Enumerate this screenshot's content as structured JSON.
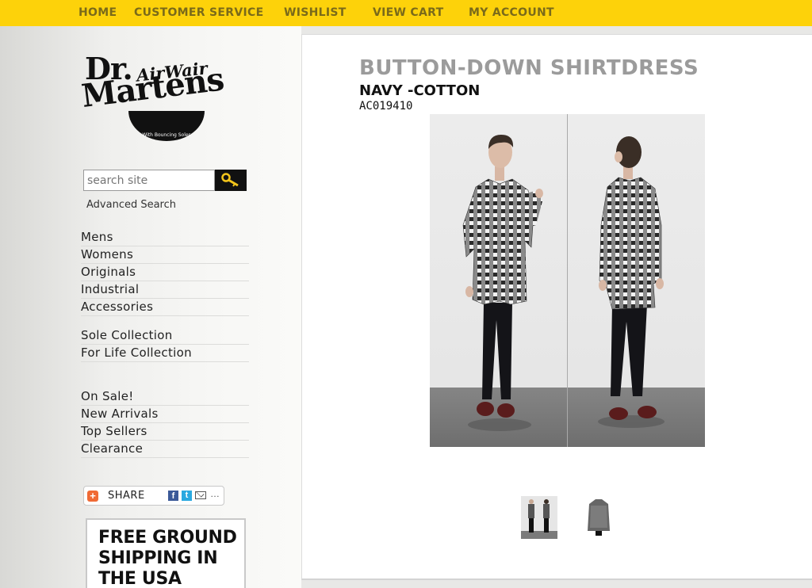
{
  "topnav": {
    "items": [
      "HOME",
      "CUSTOMER SERVICE",
      "WISHLIST",
      "VIEW CART",
      "MY ACCOUNT"
    ]
  },
  "logo": {
    "line1": "Dr.",
    "line2": "AirWair",
    "line3": "Martens",
    "sole_text": "With Bouncing Soles"
  },
  "search": {
    "placeholder": "search site",
    "advanced_label": "Advanced Search",
    "button_icon": "key-search-icon"
  },
  "categories": {
    "group1": [
      "Mens",
      "Womens",
      "Originals",
      "Industrial",
      "Accessories"
    ],
    "group2": [
      "Sole Collection",
      "For Life Collection"
    ],
    "group3": [
      "On Sale!",
      "New Arrivals",
      "Top Sellers",
      "Clearance"
    ]
  },
  "share": {
    "label": "SHARE",
    "icons": [
      "plus-icon",
      "facebook-icon",
      "twitter-icon",
      "email-icon",
      "more-icon"
    ]
  },
  "promo": {
    "lines": [
      "FREE GROUND",
      "SHIPPING IN",
      "THE USA"
    ]
  },
  "product": {
    "title": "BUTTON-DOWN SHIRTDRESS",
    "variant": "NAVY -COTTON",
    "sku": "AC019410",
    "views": [
      "front-view-photo",
      "back-view-photo"
    ],
    "thumbnails": [
      "thumbnail-full-outfit",
      "thumbnail-shirt-detail"
    ]
  },
  "colors": {
    "nav_bar": "#fdd20a",
    "nav_text": "#7a6a1a",
    "title_gray": "#9b9b9b"
  }
}
